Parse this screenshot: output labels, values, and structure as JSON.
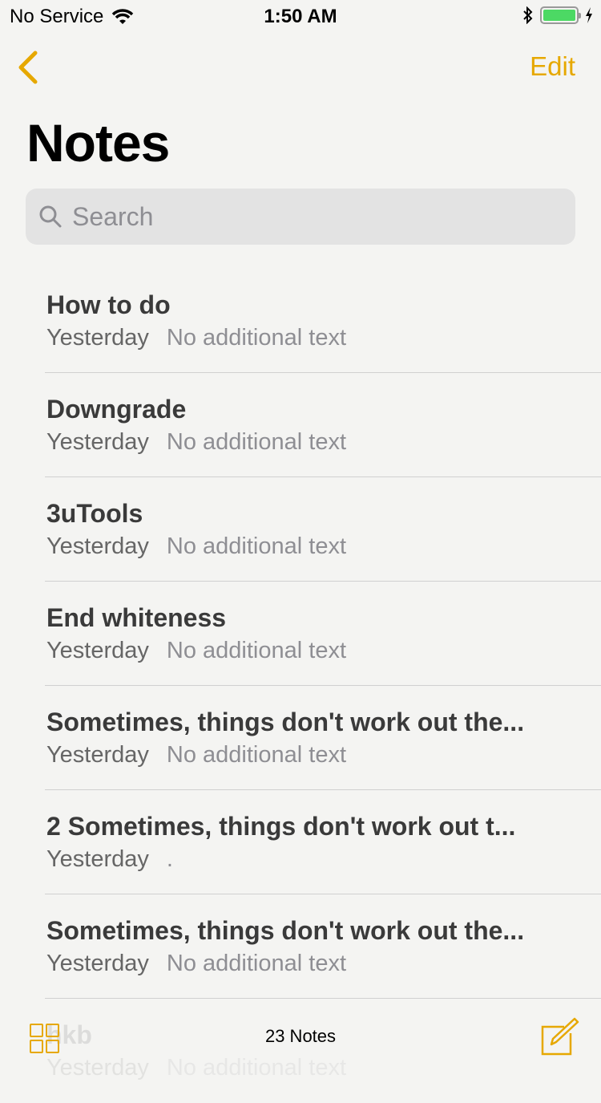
{
  "status_bar": {
    "carrier": "No Service",
    "time": "1:50 AM",
    "battery_level": 1.0,
    "charging": true
  },
  "nav": {
    "back_icon": "chevron-left",
    "edit_label": "Edit"
  },
  "page": {
    "title": "Notes"
  },
  "search": {
    "placeholder": "Search",
    "value": ""
  },
  "notes": [
    {
      "title": "How to do",
      "date": "Yesterday",
      "preview": "No additional text"
    },
    {
      "title": "Downgrade",
      "date": "Yesterday",
      "preview": "No additional text"
    },
    {
      "title": "3uTools",
      "date": "Yesterday",
      "preview": "No additional text"
    },
    {
      "title": "End whiteness",
      "date": "Yesterday",
      "preview": "No additional text"
    },
    {
      "title": "Sometimes, things don't work out the...",
      "date": "Yesterday",
      "preview": "No additional text"
    },
    {
      "title": "2 Sometimes, things don't work out t...",
      "date": "Yesterday",
      "preview": "."
    },
    {
      "title": "Sometimes, things don't work out the...",
      "date": "Yesterday",
      "preview": "No additional text"
    },
    {
      "title": "hkb",
      "date": "Yesterday",
      "preview": "No additional text"
    }
  ],
  "toolbar": {
    "count": "23 Notes"
  },
  "colors": {
    "accent": "#e6a800",
    "battery": "#4cd964"
  }
}
